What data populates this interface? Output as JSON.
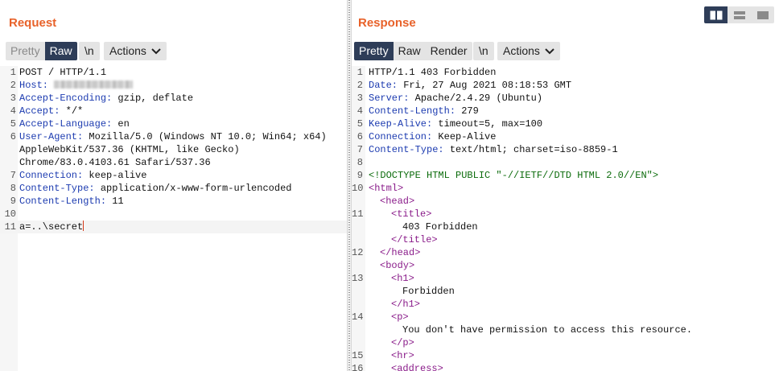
{
  "request": {
    "title": "Request",
    "view_tabs": [
      {
        "label": "Pretty",
        "state": "disabled"
      },
      {
        "label": "Raw",
        "state": "selected"
      }
    ],
    "newline_label": "\\n",
    "actions_label": "Actions",
    "lines": [
      {
        "num": "1",
        "key": "",
        "value": "POST / HTTP/1.1"
      },
      {
        "num": "2",
        "key": "Host:",
        "value": " ",
        "redacted": true
      },
      {
        "num": "3",
        "key": "Accept-Encoding:",
        "value": " gzip, deflate"
      },
      {
        "num": "4",
        "key": "Accept:",
        "value": " */*"
      },
      {
        "num": "5",
        "key": "Accept-Language:",
        "value": " en"
      },
      {
        "num": "6",
        "key": "User-Agent:",
        "value": " Mozilla/5.0 (Windows NT 10.0; Win64; x64)"
      },
      {
        "num": "",
        "key": "",
        "value": "AppleWebKit/537.36 (KHTML, like Gecko)"
      },
      {
        "num": "",
        "key": "",
        "value": "Chrome/83.0.4103.61 Safari/537.36"
      },
      {
        "num": "7",
        "key": "Connection:",
        "value": " keep-alive"
      },
      {
        "num": "8",
        "key": "Content-Type:",
        "value": " application/x-www-form-urlencoded"
      },
      {
        "num": "9",
        "key": "Content-Length:",
        "value": " 11"
      },
      {
        "num": "10",
        "key": "",
        "value": ""
      },
      {
        "num": "11",
        "key": "",
        "value": "a=..\\secret",
        "active": true
      }
    ]
  },
  "response": {
    "title": "Response",
    "view_tabs": [
      {
        "label": "Pretty",
        "state": "selected"
      },
      {
        "label": "Raw",
        "state": "normal"
      },
      {
        "label": "Render",
        "state": "normal"
      }
    ],
    "newline_label": "\\n",
    "actions_label": "Actions",
    "lines": [
      {
        "num": "1",
        "key": "",
        "value": "HTTP/1.1 403 Forbidden"
      },
      {
        "num": "2",
        "key": "Date:",
        "value": " Fri, 27 Aug 2021 08:18:53 GMT"
      },
      {
        "num": "3",
        "key": "Server:",
        "value": " Apache/2.4.29 (Ubuntu)"
      },
      {
        "num": "4",
        "key": "Content-Length:",
        "value": " 279"
      },
      {
        "num": "5",
        "key": "Keep-Alive:",
        "value": " timeout=5, max=100"
      },
      {
        "num": "6",
        "key": "Connection:",
        "value": " Keep-Alive"
      },
      {
        "num": "7",
        "key": "Content-Type:",
        "value": " text/html; charset=iso-8859-1"
      },
      {
        "num": "8",
        "key": "",
        "value": ""
      },
      {
        "num": "9",
        "kind": "doctype",
        "value": "<!DOCTYPE HTML PUBLIC \"-//IETF//DTD HTML 2.0//EN\">"
      },
      {
        "num": "10",
        "kind": "tag",
        "indent": 0,
        "value": "<html>"
      },
      {
        "num": "",
        "kind": "tag",
        "indent": 1,
        "value": "<head>"
      },
      {
        "num": "11",
        "kind": "tag",
        "indent": 2,
        "value": "<title>"
      },
      {
        "num": "",
        "kind": "text",
        "indent": 3,
        "value": "403 Forbidden"
      },
      {
        "num": "",
        "kind": "tag",
        "indent": 2,
        "value": "</title>"
      },
      {
        "num": "12",
        "kind": "tag",
        "indent": 1,
        "value": "</head>"
      },
      {
        "num": "",
        "kind": "tag",
        "indent": 1,
        "value": "<body>"
      },
      {
        "num": "13",
        "kind": "tag",
        "indent": 2,
        "value": "<h1>"
      },
      {
        "num": "",
        "kind": "text",
        "indent": 3,
        "value": "Forbidden"
      },
      {
        "num": "",
        "kind": "tag",
        "indent": 2,
        "value": "</h1>"
      },
      {
        "num": "14",
        "kind": "tag",
        "indent": 2,
        "value": "<p>"
      },
      {
        "num": "",
        "kind": "text",
        "indent": 3,
        "value": "You don't have permission to access this resource."
      },
      {
        "num": "",
        "kind": "tag",
        "indent": 2,
        "value": "</p>"
      },
      {
        "num": "15",
        "kind": "tag",
        "indent": 2,
        "value": "<hr>"
      },
      {
        "num": "16",
        "kind": "tag",
        "indent": 2,
        "value": "<address>"
      }
    ]
  },
  "layout_switch": {
    "icons": [
      "side-by-side-icon",
      "stacked-rows-icon",
      "single-pane-icon"
    ],
    "selected": 0
  },
  "colors": {
    "title": "#e8622a",
    "selected_tab": "#2e3d58",
    "header_key": "#1c3bb0",
    "html_tag": "#8a1c8a",
    "doctype": "#0b6b0b"
  }
}
